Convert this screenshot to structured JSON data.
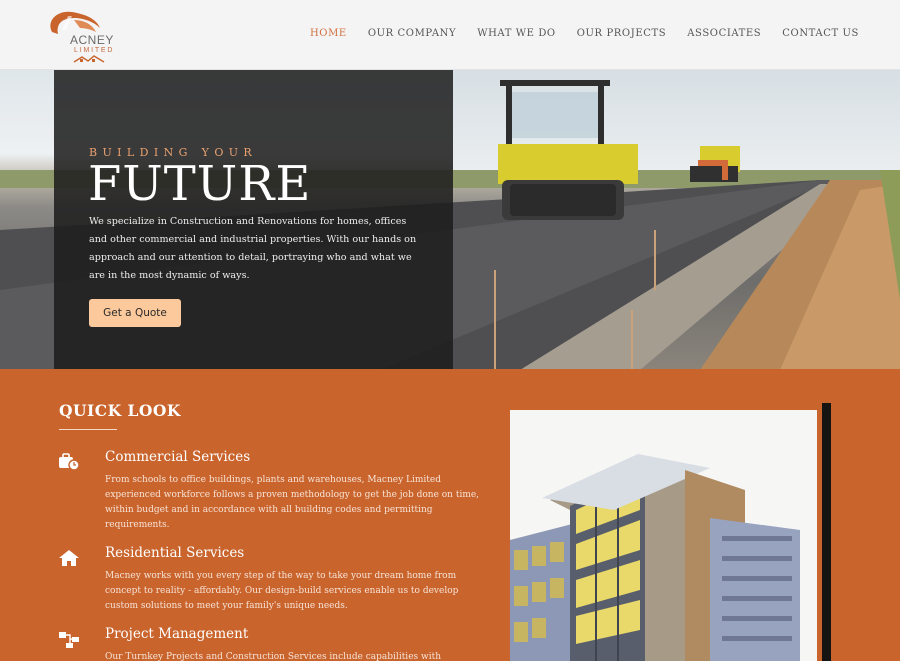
{
  "brand": {
    "name": "ACNEY",
    "sub": "LIMITED"
  },
  "nav": {
    "items": [
      {
        "label": "HOME",
        "active": true
      },
      {
        "label": "OUR COMPANY",
        "active": false
      },
      {
        "label": "WHAT WE DO",
        "active": false
      },
      {
        "label": "OUR PROJECTS",
        "active": false
      },
      {
        "label": "ASSOCIATES",
        "active": false
      },
      {
        "label": "CONTACT US",
        "active": false
      }
    ]
  },
  "hero": {
    "kicker": "BUILDING YOUR",
    "headline": "FUTURE",
    "lead": "We specialize in Construction and Renovations for homes, offices and other commercial and industrial properties. With our hands on approach and our attention to detail, portraying who and what we are in the most dynamic of ways.",
    "cta_label": "Get a Quote"
  },
  "quick_look": {
    "title": "QUICK LOOK",
    "services": [
      {
        "icon": "briefcase-clock-icon",
        "title": "Commercial Services",
        "text": "From schools to office buildings, plants and warehouses, Macney Limited experienced workforce follows a proven methodology to get the job done on time, within budget and in accordance with all building codes and permitting requirements."
      },
      {
        "icon": "home-icon",
        "title": "Residential Services",
        "text": "Macney works with you every step of the way to take your dream home from concept to reality - affordably. Our design-build services enable us to develop custom solutions to meet your family's unique needs."
      },
      {
        "icon": "sitemap-icon",
        "title": "Project Management",
        "text": "Our Turnkey Projects and Construction Services include capabilities with proprietary"
      }
    ]
  },
  "colors": {
    "accent": "#d0703f",
    "section_bg": "#c9642d",
    "cta_bg": "#fbc99c",
    "hero_overlay": "#1c1c1c"
  }
}
